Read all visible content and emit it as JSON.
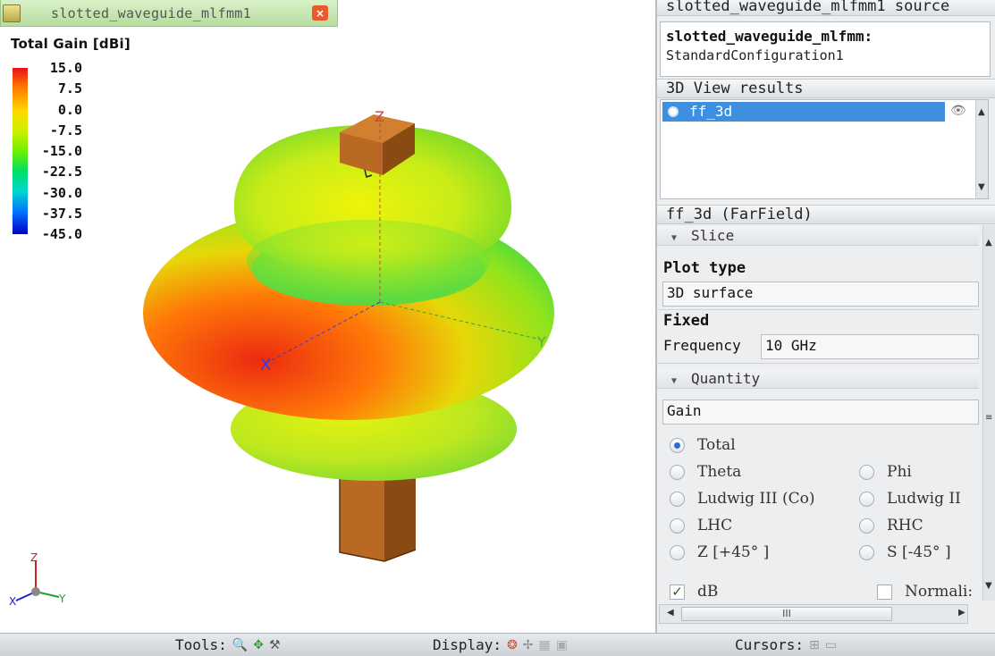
{
  "document_tab": {
    "title": "slotted_waveguide_mlfmm1",
    "close_label": "×"
  },
  "legend": {
    "title": "Total Gain [dBi]",
    "ticks": [
      "15.0",
      "7.5",
      "0.0",
      "-7.5",
      "-15.0",
      "-22.5",
      "-30.0",
      "-37.5",
      "-45.0"
    ],
    "range": [
      -45,
      15
    ]
  },
  "scene": {
    "axis_labels": {
      "x": "X",
      "y": "Y",
      "z": "Z"
    },
    "triad_labels": {
      "x": "X",
      "y": "Y",
      "z": "Z"
    }
  },
  "colors": {
    "accent_selected": "#3f8fe0",
    "gain_max": "#e8121a",
    "gain_min": "#0000c8",
    "waveguide": "#b8651c"
  },
  "panel": {
    "source_header": "slotted_waveguide_mlfmm1 source",
    "source_name": "slotted_waveguide_mlfmm:",
    "source_config": "StandardConfiguration1",
    "results_header": "3D View results",
    "result_item": "ff_3d",
    "properties_header": "ff_3d (FarField)",
    "slice_label": "Slice",
    "plot_type_label": "Plot type",
    "plot_type_value": "3D surface",
    "fixed_label": "Fixed",
    "frequency_label": "Frequency",
    "frequency_value": "10 GHz",
    "quantity_label": "Quantity",
    "quantity_value": "Gain",
    "components": {
      "total": "Total",
      "theta": "Theta",
      "phi": "Phi",
      "ludwig_co": "Ludwig III (Co)",
      "ludwig_cross": "Ludwig II",
      "lhc": "LHC",
      "rhc": "RHC",
      "z45": "Z [+45° ]",
      "s45": "S [-45° ]"
    },
    "selected_component": "Total",
    "db_label": "dB",
    "db_checked": true,
    "normalise_label": "Normali:",
    "normalise_checked": false,
    "scroll_thumb_label": "III"
  },
  "toolbar": {
    "tools_label": "Tools:",
    "display_label": "Display:",
    "cursors_label": "Cursors:"
  }
}
